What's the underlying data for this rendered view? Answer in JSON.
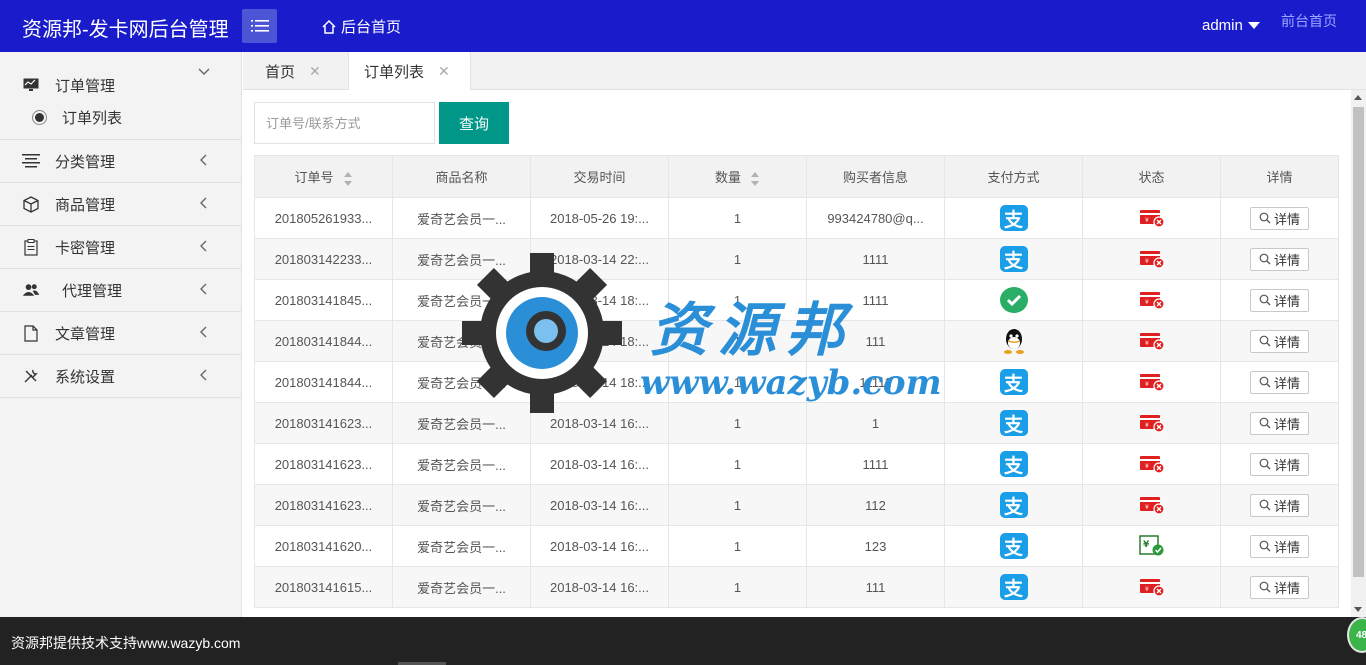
{
  "header": {
    "brand": "资源邦-发卡网后台管理",
    "home_label": "后台首页",
    "user_name": "admin",
    "front_link": "前台首页"
  },
  "sidebar": {
    "items": [
      {
        "label": "订单管理",
        "icon": "chart-monitor-icon",
        "expanded": true,
        "sub": [
          {
            "label": "订单列表"
          }
        ]
      },
      {
        "label": "分类管理",
        "icon": "align-list-icon"
      },
      {
        "label": "商品管理",
        "icon": "cube-icon"
      },
      {
        "label": "卡密管理",
        "icon": "clipboard-icon"
      },
      {
        "label": "代理管理",
        "icon": "users-icon"
      },
      {
        "label": "文章管理",
        "icon": "document-icon"
      },
      {
        "label": "系统设置",
        "icon": "tools-icon"
      }
    ]
  },
  "tabs": [
    {
      "label": "首页"
    },
    {
      "label": "订单列表"
    }
  ],
  "search": {
    "placeholder": "订单号/联系方式",
    "button_label": "查询"
  },
  "table": {
    "columns": [
      "订单号",
      "商品名称",
      "交易时间",
      "数量",
      "购买者信息",
      "支付方式",
      "状态",
      "详情"
    ],
    "detail_label": "详情",
    "rows": [
      {
        "order": "201805261933...",
        "product": "爱奇艺会员一...",
        "time": "2018-05-26 19:...",
        "qty": "1",
        "buyer": "993424780@q...",
        "pay": "alipay",
        "status": "unpaid"
      },
      {
        "order": "201803142233...",
        "product": "爱奇艺会员一...",
        "time": "2018-03-14 22:...",
        "qty": "1",
        "buyer": "1111",
        "pay": "alipay",
        "status": "unpaid"
      },
      {
        "order": "201803141845...",
        "product": "爱奇艺会员一...",
        "time": "2018-03-14 18:...",
        "qty": "1",
        "buyer": "1111",
        "pay": "wechat",
        "status": "unpaid"
      },
      {
        "order": "201803141844...",
        "product": "爱奇艺会员一...",
        "time": "2018-03-14 18:...",
        "qty": "1",
        "buyer": "111",
        "pay": "qq",
        "status": "unpaid"
      },
      {
        "order": "201803141844...",
        "product": "爱奇艺会员一...",
        "time": "2018-03-14 18:...",
        "qty": "1",
        "buyer": "11111",
        "pay": "alipay",
        "status": "unpaid"
      },
      {
        "order": "201803141623...",
        "product": "爱奇艺会员一...",
        "time": "2018-03-14 16:...",
        "qty": "1",
        "buyer": "1",
        "pay": "alipay",
        "status": "unpaid"
      },
      {
        "order": "201803141623...",
        "product": "爱奇艺会员一...",
        "time": "2018-03-14 16:...",
        "qty": "1",
        "buyer": "1111",
        "pay": "alipay",
        "status": "unpaid"
      },
      {
        "order": "201803141623...",
        "product": "爱奇艺会员一...",
        "time": "2018-03-14 16:...",
        "qty": "1",
        "buyer": "112",
        "pay": "alipay",
        "status": "unpaid"
      },
      {
        "order": "201803141620...",
        "product": "爱奇艺会员一...",
        "time": "2018-03-14 16:...",
        "qty": "1",
        "buyer": "123",
        "pay": "alipay",
        "status": "paid"
      },
      {
        "order": "201803141615...",
        "product": "爱奇艺会员一...",
        "time": "2018-03-14 16:...",
        "qty": "1",
        "buyer": "111",
        "pay": "alipay",
        "status": "unpaid"
      }
    ]
  },
  "watermark": {
    "text": "资源邦",
    "url": "www.wazyb.com"
  },
  "footer": {
    "text": "资源邦提供技术支持www.wazyb.com",
    "badge": "48"
  },
  "colors": {
    "header_bg": "#1a1ccc",
    "primary_button": "#009688",
    "alipay": "#1a9ee8",
    "wechat": "#2aae67",
    "status_unpaid": "#e02020",
    "status_paid": "#2a9a3a"
  }
}
